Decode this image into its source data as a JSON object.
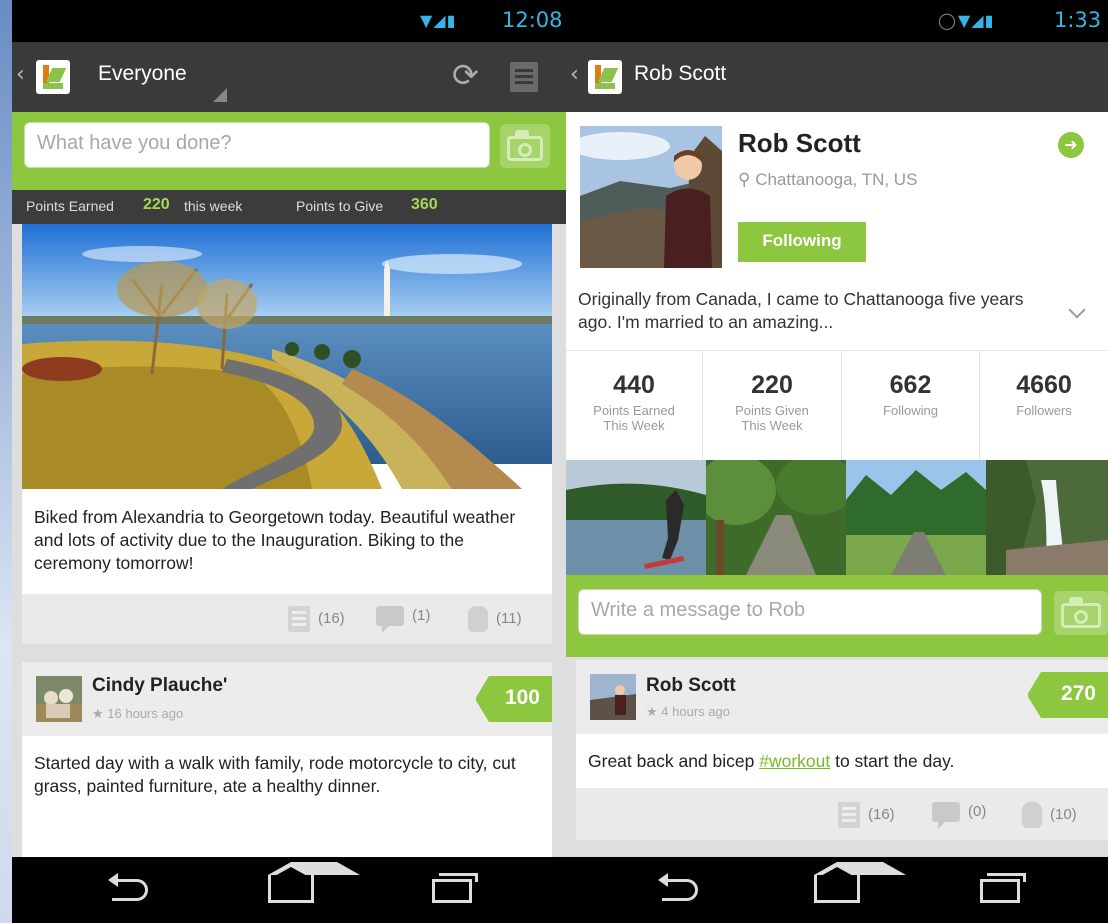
{
  "left": {
    "status": {
      "time": "12:08"
    },
    "actionbar": {
      "title": "Everyone"
    },
    "compose": {
      "placeholder": "What have you done?"
    },
    "points": {
      "earned_label": "Points Earned",
      "earned_value": "220",
      "earned_suffix": "this week",
      "give_label": "Points to Give",
      "give_value": "360"
    },
    "post1": {
      "text": "Biked from Alexandria to Georgetown today. Beautiful weather and lots of activity due to the Inauguration. Biking to the ceremony tomorrow!",
      "lists": "(16)",
      "comments": "(1)",
      "props": "(11)"
    },
    "post2": {
      "user": "Cindy Plauche'",
      "time": "16 hours ago",
      "points": "100",
      "text": "Started day with a walk with family, rode motorcycle to city, cut grass, painted furniture, ate a healthy dinner."
    }
  },
  "right": {
    "status": {
      "time": "1:33"
    },
    "actionbar": {
      "title": "Rob Scott"
    },
    "profile": {
      "name": "Rob Scott",
      "location": "Chattanooga, TN, US",
      "follow_label": "Following",
      "bio": "Originally from Canada, I came to Chattanooga five years ago. I'm married to an amazing..."
    },
    "stats": [
      {
        "value": "440",
        "label1": "Points Earned",
        "label2": "This Week"
      },
      {
        "value": "220",
        "label1": "Points Given",
        "label2": "This Week"
      },
      {
        "value": "662",
        "label1": "Following",
        "label2": ""
      },
      {
        "value": "4660",
        "label1": "Followers",
        "label2": ""
      }
    ],
    "compose": {
      "placeholder": "Write a message to Rob"
    },
    "post": {
      "user": "Rob Scott",
      "time": "4 hours ago",
      "points": "270",
      "text_before": "Great back and bicep ",
      "hashtag": "#workout",
      "text_after": " to start the day.",
      "lists": "(16)",
      "comments": "(0)",
      "props": "(10)"
    }
  },
  "colors": {
    "accent_green": "#8dc63f",
    "status_blue": "#33b5e5",
    "actionbar": "#3a3a3a"
  },
  "icons": [
    "back-icon",
    "app-logo-icon",
    "refresh-icon",
    "menu-icon",
    "camera-icon",
    "list-icon",
    "comment-icon",
    "props-hand-icon",
    "star-icon",
    "location-pin-icon",
    "arrow-right-icon",
    "chevron-down-icon",
    "nav-back-icon",
    "nav-home-icon",
    "nav-recent-icon"
  ]
}
